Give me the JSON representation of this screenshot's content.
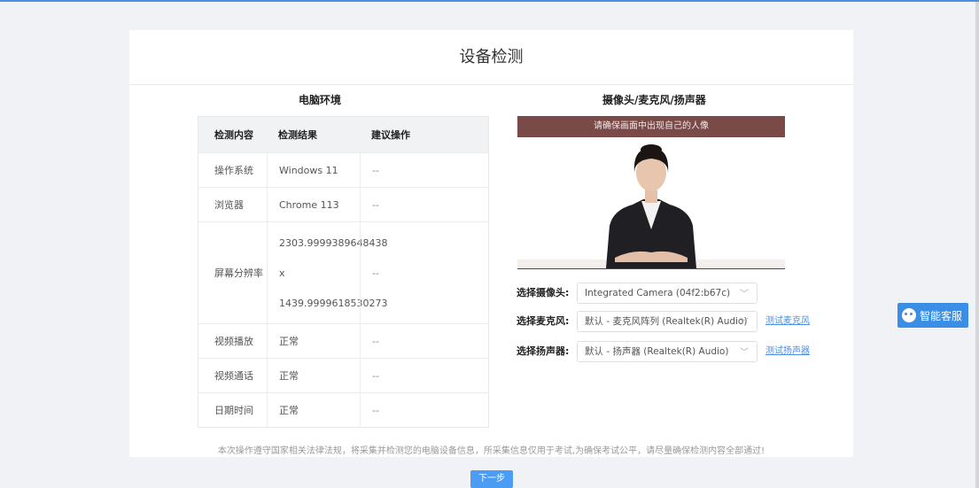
{
  "page": {
    "title": "设备检测"
  },
  "env": {
    "title": "电脑环境",
    "headers": [
      "检测内容",
      "检测结果",
      "建议操作"
    ],
    "rows": [
      {
        "item": "操作系统",
        "result": "Windows 11",
        "action": "--"
      },
      {
        "item": "浏览器",
        "result": "Chrome 113",
        "action": "--"
      },
      {
        "item": "屏幕分辨率",
        "result_lines": [
          "2303.9999389648438",
          "x",
          "1439.9999618530273"
        ],
        "action": "--"
      },
      {
        "item": "视频播放",
        "result": "正常",
        "action": "--"
      },
      {
        "item": "视频通话",
        "result": "正常",
        "action": "--"
      },
      {
        "item": "日期时间",
        "result": "正常",
        "action": "--"
      }
    ]
  },
  "camera": {
    "title": "摄像头/麦克风/扬声器",
    "banner": "请确保画面中出现自己的人像",
    "fields": [
      {
        "label": "选择摄像头:",
        "value": "Integrated Camera (04f2:b67c)",
        "test": ""
      },
      {
        "label": "选择麦克风:",
        "value": "默认 - 麦克风阵列 (Realtek(R) Audio)",
        "test": "测试麦克风"
      },
      {
        "label": "选择扬声器:",
        "value": "默认 - 扬声器 (Realtek(R) Audio)",
        "test": "测试扬声器"
      }
    ]
  },
  "notice": "本次操作遵守国家相关法律法规，将采集并检测您的电脑设备信息，所采集信息仅用于考试,为确保考试公平，请尽量确保检测内容全部通过!",
  "next_button": "下一步",
  "service_button": "智能客服",
  "colors": {
    "accent": "#4a8fe0",
    "banner": "#7a4a48",
    "service": "#3a8ee6"
  }
}
